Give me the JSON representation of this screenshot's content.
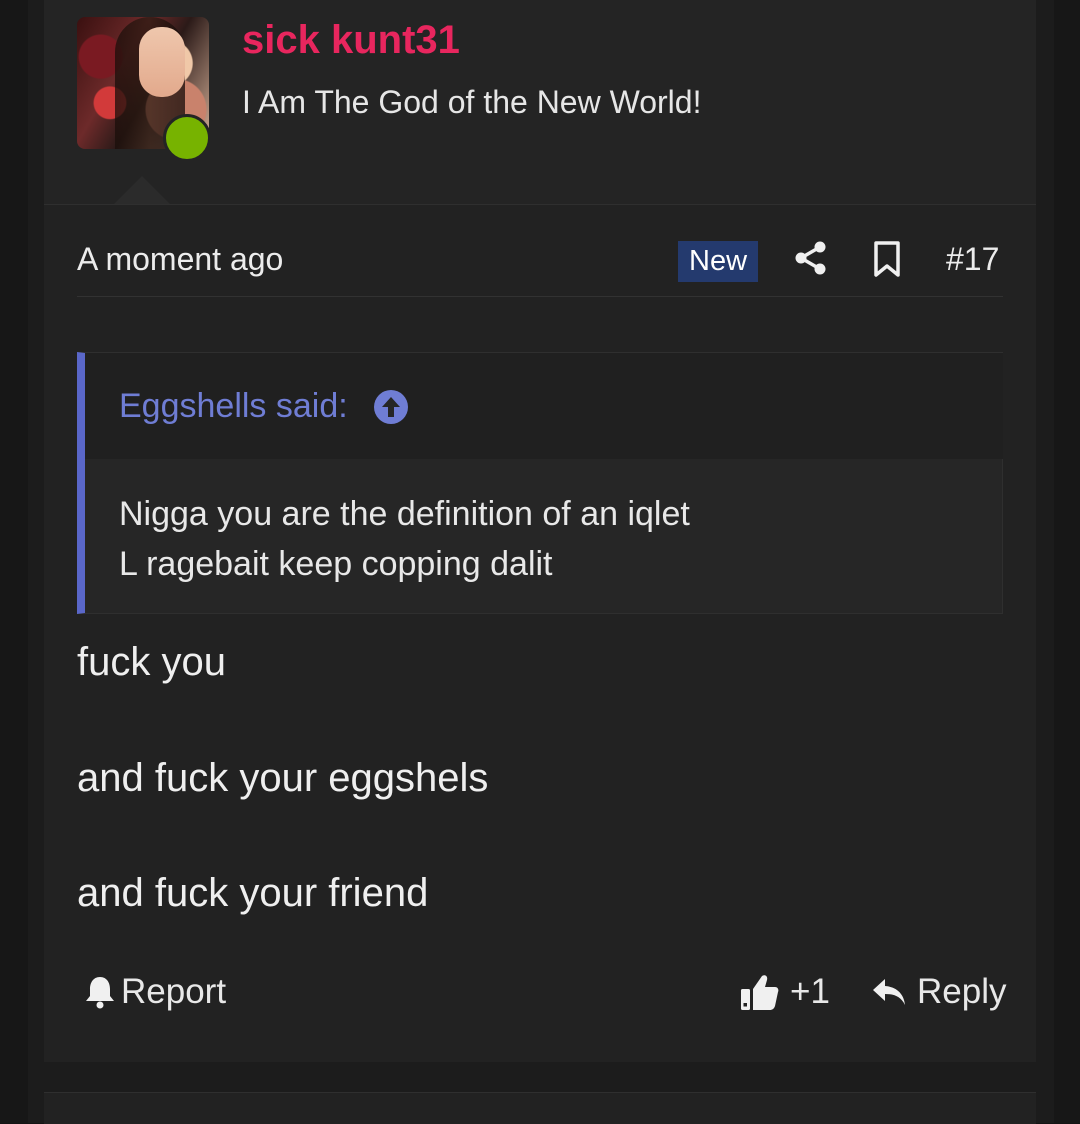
{
  "user": {
    "name": "sick kunt31",
    "title": "I Am The God of the New World!",
    "online": true
  },
  "meta": {
    "time": "A moment ago",
    "badge": "New",
    "post_number": "#17"
  },
  "quote": {
    "author": "Eggshells said:",
    "lines": [
      "Nigga you are the definition of an iqlet",
      "L ragebait keep copping dalit"
    ]
  },
  "message": {
    "lines": [
      "fuck you",
      "and fuck your eggshels",
      "and fuck your friend"
    ]
  },
  "actions": {
    "report": "Report",
    "reaction_count": "+1",
    "reply": "Reply"
  },
  "colors": {
    "username": "#e8265e",
    "quote_accent": "#5a67c9",
    "badge_bg": "#243a6e",
    "online": "#77b300"
  }
}
